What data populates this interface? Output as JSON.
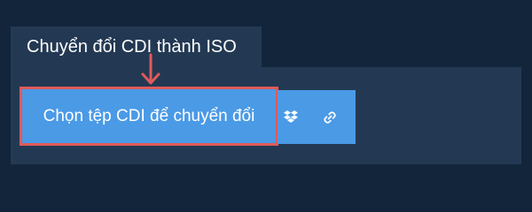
{
  "tab": {
    "title": "Chuyển đổi CDI thành ISO"
  },
  "upload": {
    "button_label": "Chọn tệp CDI để chuyển đổi"
  },
  "icons": {
    "arrow": "arrow-down-icon",
    "dropbox": "dropbox-icon",
    "link": "link-icon"
  },
  "colors": {
    "background": "#13253a",
    "panel": "#233953",
    "button": "#4a9ae6",
    "highlight": "#e05a5a",
    "text": "#ffffff"
  }
}
